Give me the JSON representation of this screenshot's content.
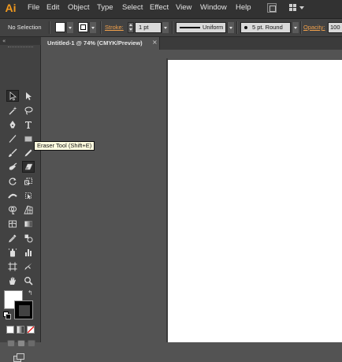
{
  "app": {
    "logo": "Ai",
    "logo_color": "#f29a1e"
  },
  "menu": {
    "items": [
      "File",
      "Edit",
      "Object",
      "Type",
      "Select",
      "Effect",
      "View",
      "Window",
      "Help"
    ]
  },
  "control_bar": {
    "selection_label": "No Selection",
    "stroke_label": "Stroke:",
    "stroke_weight": "1 pt",
    "stroke_profile": "Uniform",
    "brush_definition": "5 pt. Round",
    "opacity_label": "Opacity:",
    "opacity_value": "100"
  },
  "document": {
    "tab_label": "Untitled-1 @ 74% (CMYK/Preview)",
    "close_glyph": "×"
  },
  "toolbar": {
    "collapse_glyph": "«",
    "tooltip": "Eraser Tool (Shift+E)",
    "active_tool": "eraser-tool",
    "swap_glyph": "↰"
  },
  "colors": {
    "fill": "#ffffff",
    "stroke": "#000000",
    "ui_background": "#535353",
    "panel": "#424242",
    "accent_link": "#f0a04b"
  }
}
